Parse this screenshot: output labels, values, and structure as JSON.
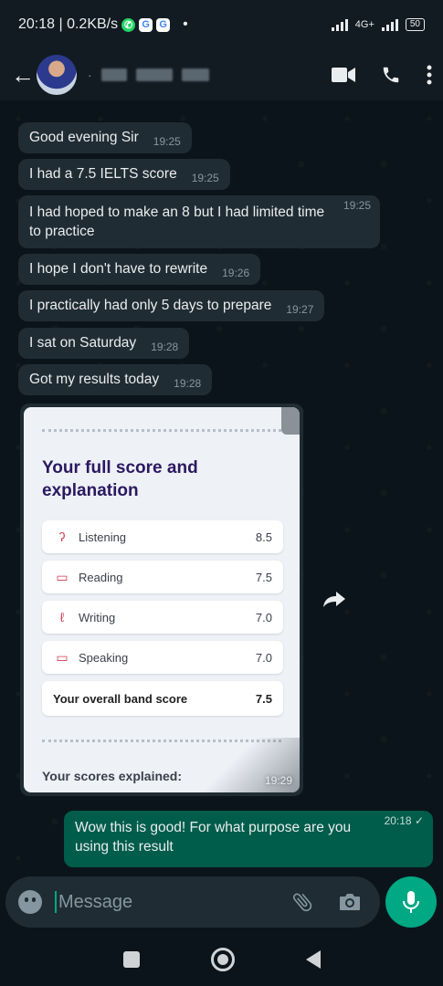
{
  "status": {
    "time_speed": "20:18 | 0.2KB/s",
    "network": "4G+",
    "battery": "50"
  },
  "header": {
    "back": "←",
    "icons": [
      "video-call-icon",
      "phone-icon",
      "more-vert-icon"
    ]
  },
  "messages": [
    {
      "text": "Good evening Sir",
      "time": "19:25"
    },
    {
      "text": "I had a 7.5 IELTS score",
      "time": "19:25"
    },
    {
      "text": "I had hoped to make an 8 but I had limited time to practice",
      "time": "19:25"
    },
    {
      "text": "I hope I don't have to rewrite",
      "time": "19:26"
    },
    {
      "text": "I practically had only 5 days to prepare",
      "time": "19:27"
    },
    {
      "text": "I sat on Saturday",
      "time": "19:28"
    },
    {
      "text": "Got my results today",
      "time": "19:28"
    }
  ],
  "image_card": {
    "title": "Your full score and explanation",
    "rows": [
      {
        "label": "Listening",
        "score": "8.5",
        "icon": "ear-icon"
      },
      {
        "label": "Reading",
        "score": "7.5",
        "icon": "book-icon"
      },
      {
        "label": "Writing",
        "score": "7.0",
        "icon": "pen-icon"
      },
      {
        "label": "Speaking",
        "score": "7.0",
        "icon": "speech-bubble-icon"
      }
    ],
    "overall_label": "Your overall band score",
    "overall_score": "7.5",
    "explained": "Your scores explained:",
    "time": "19:29"
  },
  "outgoing": {
    "text": "Wow this is good! For what purpose are you using this result",
    "time": "20:18 ✓"
  },
  "composer": {
    "placeholder": "Message"
  },
  "colors": {
    "incoming": "#202c33",
    "outgoing": "#005c4b",
    "accent": "#00a884"
  }
}
